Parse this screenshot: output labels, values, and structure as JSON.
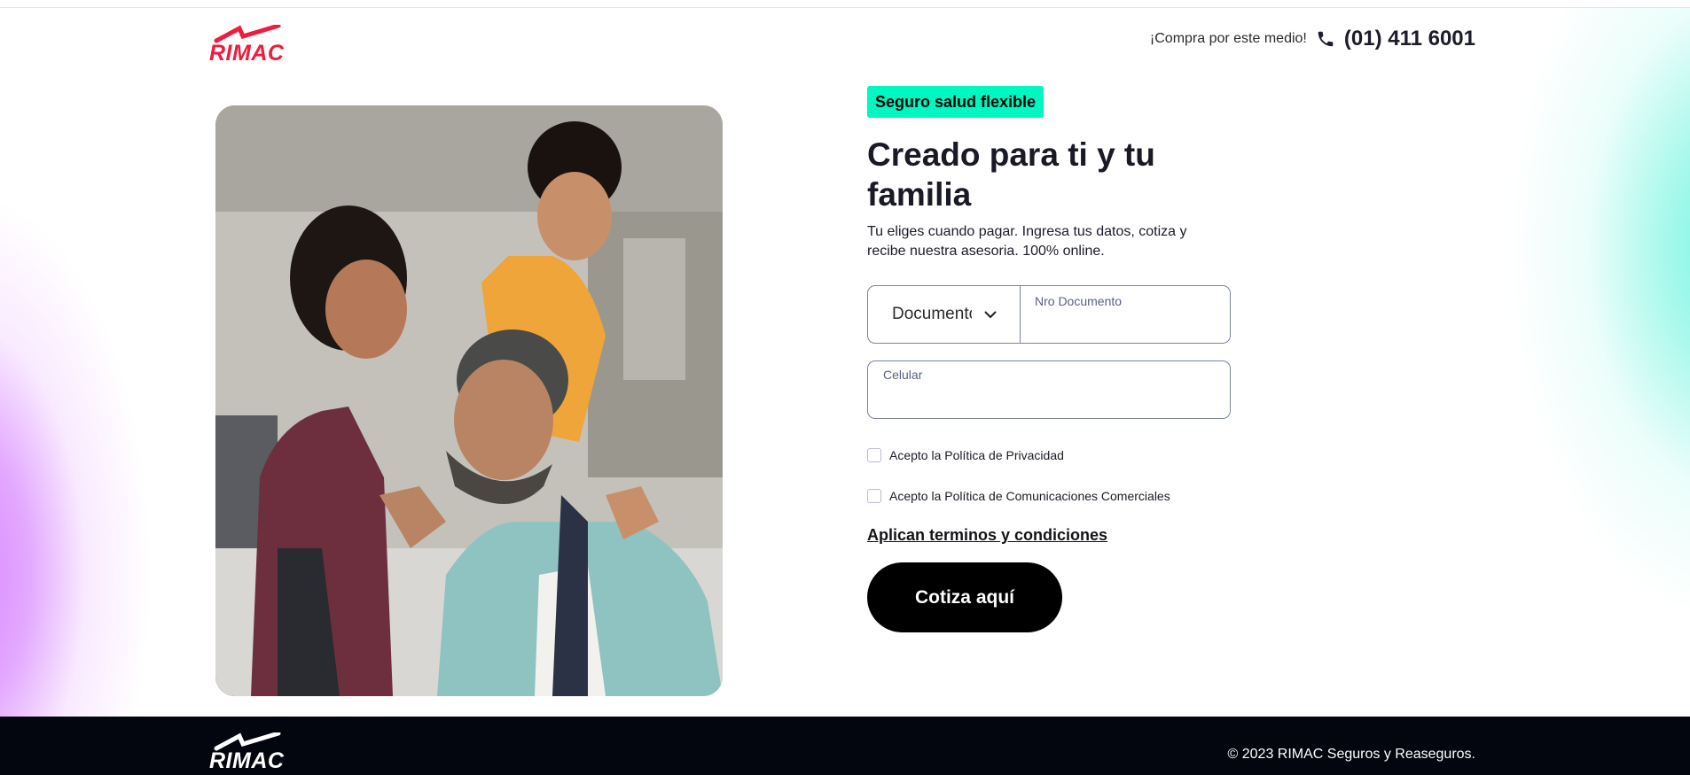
{
  "colors": {
    "brand_red": "#ef1c3c",
    "badge_green": "#00f7c1",
    "footer_bg": "#03050f",
    "cta_bg": "#000000"
  },
  "header": {
    "logo_text": "RIMAC",
    "contact_text": "¡Compra por este medio!",
    "phone_icon": "phone-icon",
    "phone_number": "(01) 411 6001"
  },
  "hero": {
    "badge": "Seguro salud flexible",
    "title": "Creado para ti y tu familia",
    "subtitle": "Tu eliges cuando pagar. Ingresa tus datos, cotiza y recibe nuestra asesoria. 100% online."
  },
  "form": {
    "document_type_value": "Documento",
    "document_number_label": "Nro Documento",
    "document_number_value": "",
    "phone_label": "Celular",
    "phone_value": "",
    "privacy_label": "Acepto la Política de Privacidad",
    "privacy_checked": false,
    "communications_label": "Acepto la Política de Comunicaciones Comerciales",
    "communications_checked": false,
    "terms_link": "Aplican terminos y condiciones",
    "submit_label": "Cotiza aquí"
  },
  "footer": {
    "logo_text": "RIMAC",
    "copyright": "© 2023 RIMAC Seguros y Reaseguros."
  }
}
